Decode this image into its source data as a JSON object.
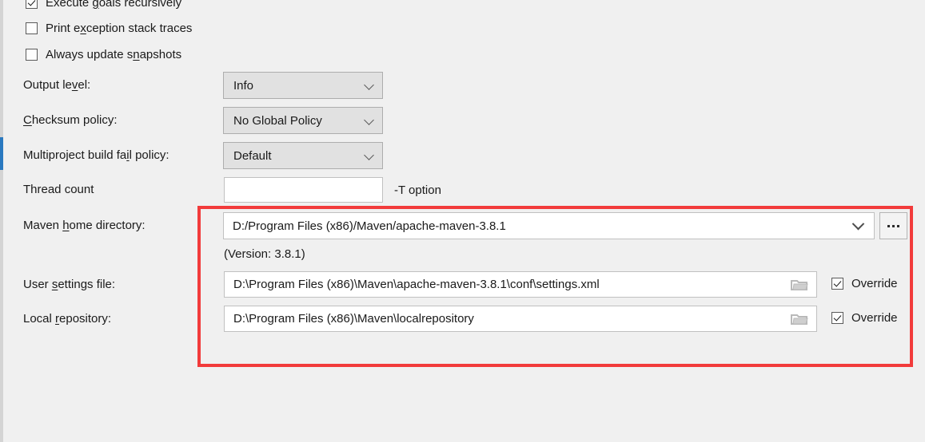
{
  "checkboxes": [
    {
      "label_pre": "Execute ",
      "mnemonic": "g",
      "label_post": "oals recursively",
      "checked": true,
      "name": "execute-goals-recursively"
    },
    {
      "label_pre": "Print e",
      "mnemonic": "x",
      "label_post": "ception stack traces",
      "checked": false,
      "name": "print-exception-stack-traces"
    },
    {
      "label_pre": "Always update s",
      "mnemonic": "n",
      "label_post": "apshots",
      "checked": false,
      "name": "always-update-snapshots"
    }
  ],
  "output_level": {
    "label_pre": "Output le",
    "mnemonic": "v",
    "label_post": "el:",
    "value": "Info"
  },
  "checksum_policy": {
    "label_pre": "",
    "mnemonic": "C",
    "label_post": "hecksum policy:",
    "value": "No Global Policy"
  },
  "multiproject_fail_policy": {
    "label_pre": "Multiproject build fa",
    "mnemonic": "i",
    "label_post": "l policy:",
    "value": "Default"
  },
  "thread_count": {
    "label": "Thread count",
    "value": "",
    "hint": "-T option"
  },
  "maven_home": {
    "label_pre": "Maven ",
    "mnemonic": "h",
    "label_post": "ome directory:",
    "value": "D:/Program Files (x86)/Maven/apache-maven-3.8.1",
    "browse_label": "...",
    "version_note": "(Version: 3.8.1)"
  },
  "user_settings_file": {
    "label_pre": "User ",
    "mnemonic": "s",
    "label_post": "ettings file:",
    "value": "D:\\Program Files (x86)\\Maven\\apache-maven-3.8.1\\conf\\settings.xml",
    "override_label": "Override",
    "override_checked": true
  },
  "local_repository": {
    "label_pre": "Local ",
    "mnemonic": "r",
    "label_post": "epository:",
    "value": "D:\\Program Files (x86)\\Maven\\localrepository",
    "override_label": "Override",
    "override_checked": true
  },
  "colors": {
    "background": "#f0f0f0",
    "highlight_rect": "#f23b3b",
    "selection_marker": "#2a79c0",
    "combo_background": "#e1e1e1",
    "input_background": "#ffffff"
  }
}
